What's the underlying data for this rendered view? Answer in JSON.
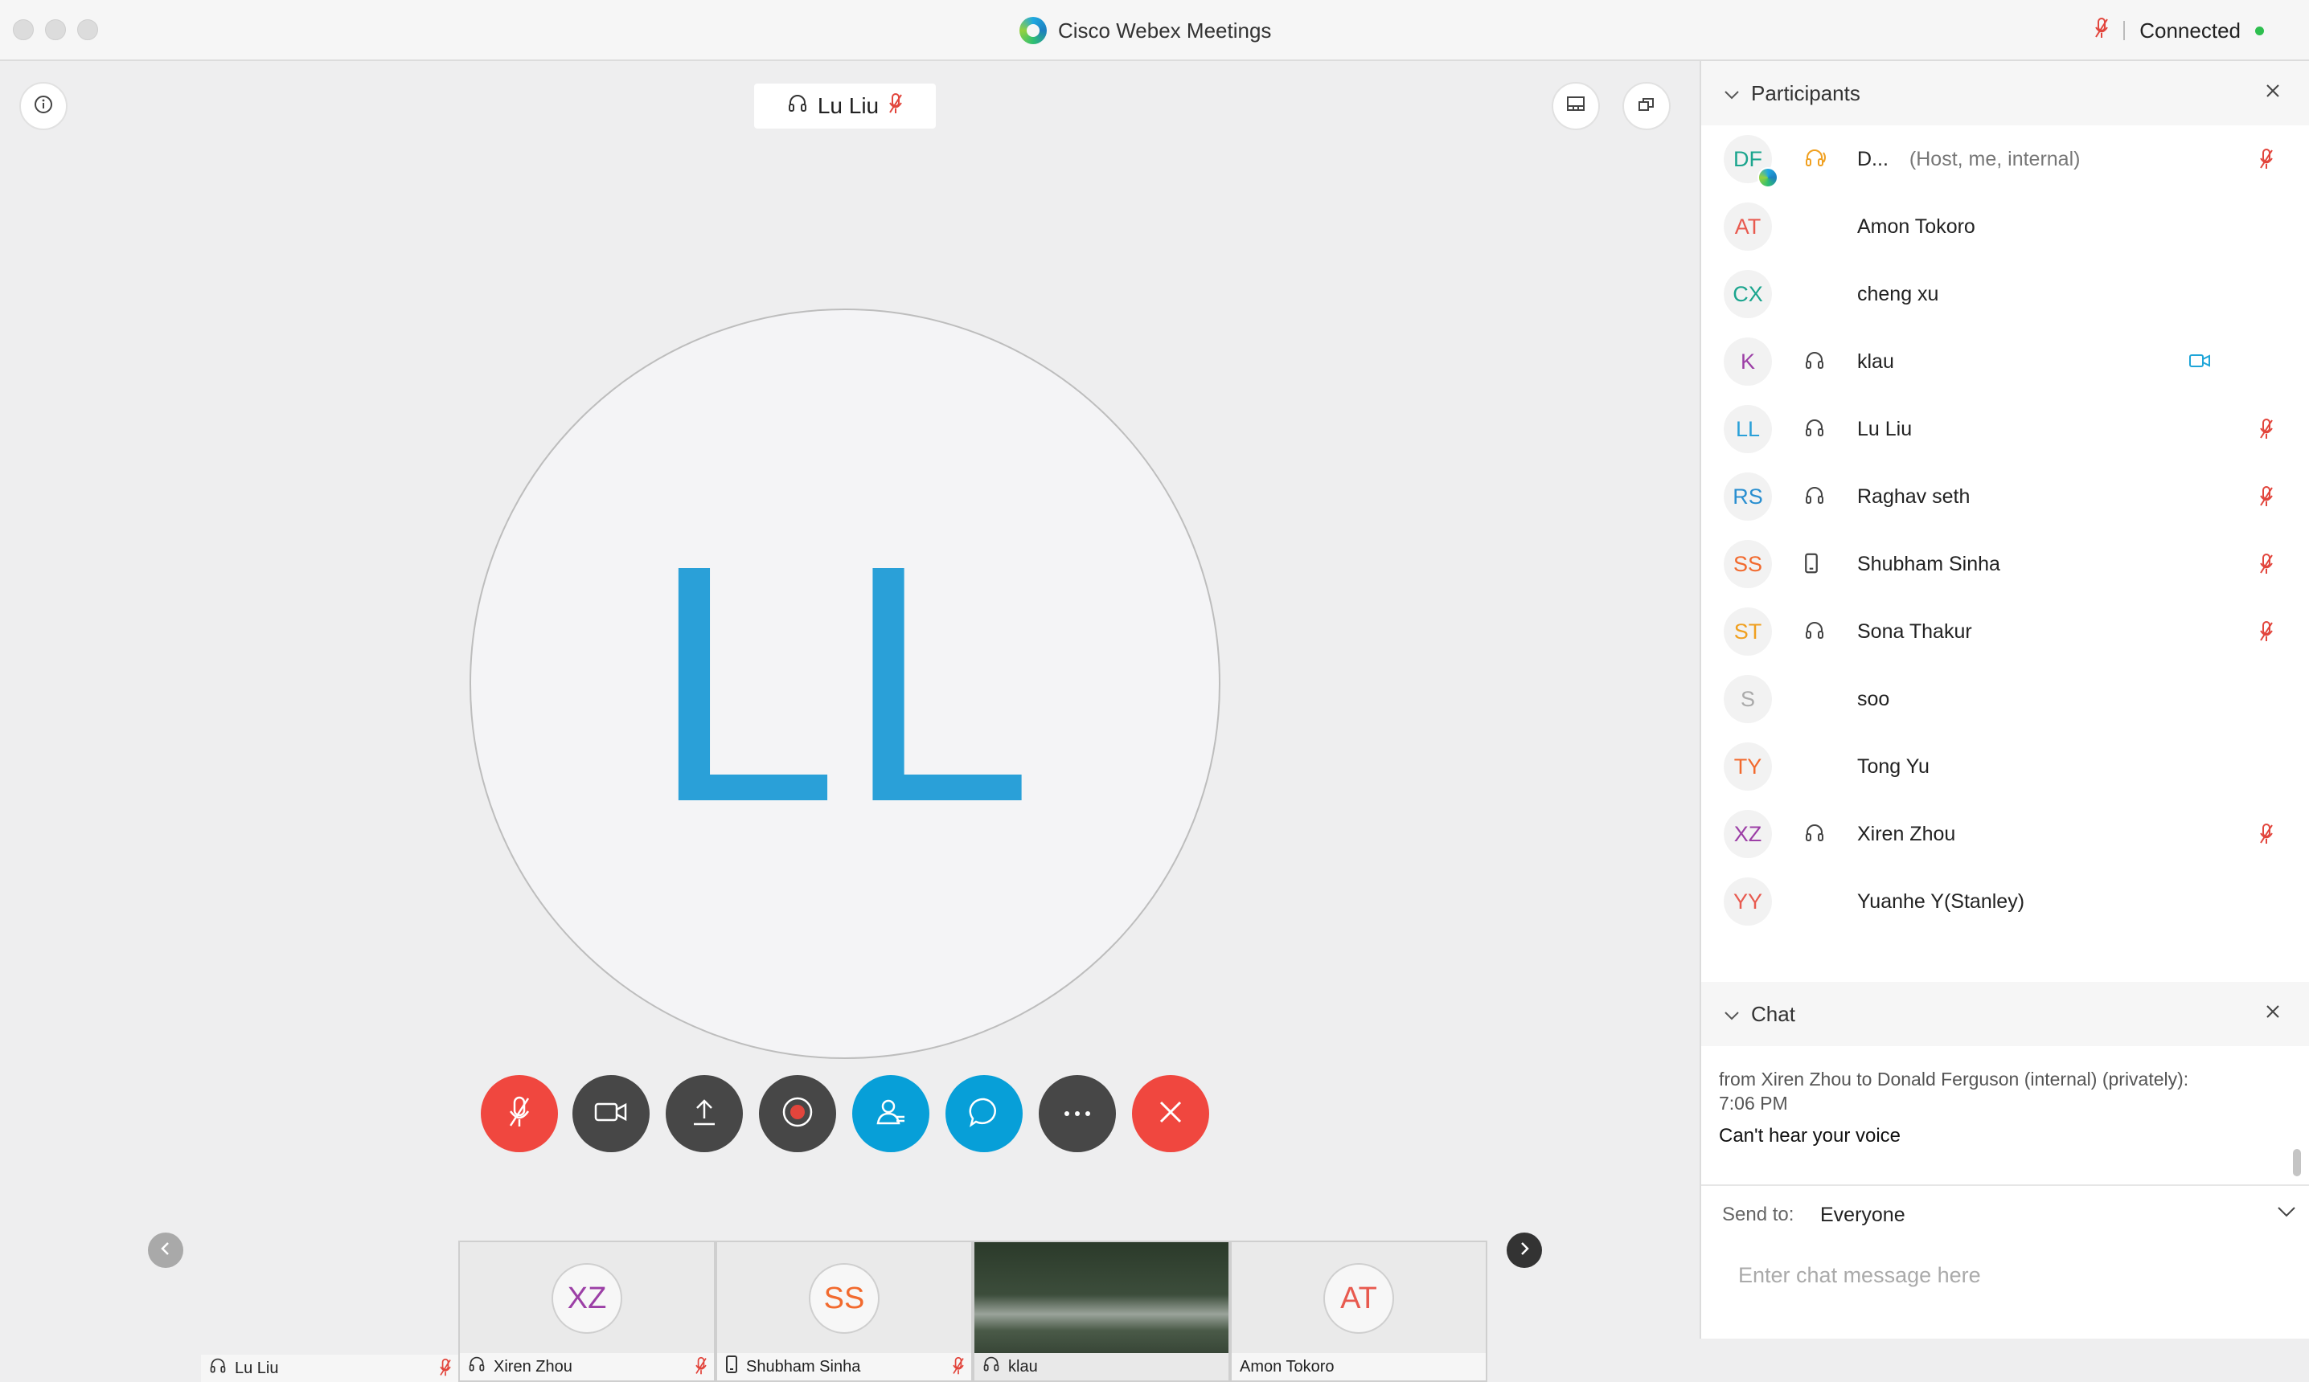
{
  "window": {
    "title": "Cisco Webex Meetings",
    "connection_status": "Connected"
  },
  "stage": {
    "active_speaker": "Lu Liu",
    "active_speaker_initials": "LL",
    "avatar_color": "#2aa0d8"
  },
  "controls": [
    {
      "name": "mute-button",
      "icon": "mic-muted-icon",
      "color": "#f0473f"
    },
    {
      "name": "video-button",
      "icon": "video-camera-icon",
      "color": "#474747"
    },
    {
      "name": "share-button",
      "icon": "share-upload-icon",
      "color": "#474747"
    },
    {
      "name": "record-button",
      "icon": "record-icon",
      "color": "#474747"
    },
    {
      "name": "participants-button",
      "icon": "participants-icon",
      "color": "#079fd8"
    },
    {
      "name": "chat-button",
      "icon": "chat-bubble-icon",
      "color": "#079fd8"
    },
    {
      "name": "more-button",
      "icon": "more-options-icon",
      "color": "#474747"
    },
    {
      "name": "leave-button",
      "icon": "close-x-icon",
      "color": "#f0473f"
    }
  ],
  "thumbnails": [
    {
      "name": "Lu Liu",
      "initials": "",
      "audio": "headset-icon",
      "muted": true
    },
    {
      "name": "Xiren Zhou",
      "initials": "XZ",
      "initials_color": "#9c3fa6",
      "audio": "headset-icon",
      "muted": true
    },
    {
      "name": "Shubham Sinha",
      "initials": "SS",
      "initials_color": "#f26a2e",
      "audio": "phone-icon",
      "muted": true
    },
    {
      "name": "klau",
      "initials": "",
      "audio": "headset-icon",
      "muted": false,
      "video": true
    },
    {
      "name": "Amon Tokoro",
      "initials": "AT",
      "initials_color": "#e85a4f",
      "audio": "",
      "muted": false
    }
  ],
  "participants_panel": {
    "title": "Participants",
    "items": [
      {
        "initials": "DF",
        "initials_color": "#1ba58e",
        "name": "D...",
        "sub": "(Host, me, internal)",
        "audio": "headset-orange-icon",
        "status": "mic-muted-icon"
      },
      {
        "initials": "AT",
        "initials_color": "#e85a4f",
        "name": "Amon Tokoro",
        "sub": "",
        "audio": "",
        "status": ""
      },
      {
        "initials": "CX",
        "initials_color": "#1ba58e",
        "name": "cheng xu",
        "sub": "",
        "audio": "",
        "status": ""
      },
      {
        "initials": "K",
        "initials_color": "#9c3fa6",
        "name": "klau",
        "sub": "",
        "audio": "headset-icon",
        "status": "video-icon"
      },
      {
        "initials": "LL",
        "initials_color": "#2aa0d8",
        "name": "Lu Liu",
        "sub": "",
        "audio": "headset-icon",
        "status": "mic-muted-icon"
      },
      {
        "initials": "RS",
        "initials_color": "#2a8fd0",
        "name": "Raghav seth",
        "sub": "",
        "audio": "headset-icon",
        "status": "mic-muted-icon"
      },
      {
        "initials": "SS",
        "initials_color": "#f26a2e",
        "name": "Shubham Sinha",
        "sub": "",
        "audio": "phone-icon",
        "status": "mic-muted-icon"
      },
      {
        "initials": "ST",
        "initials_color": "#f0a020",
        "name": "Sona Thakur",
        "sub": "",
        "audio": "headset-icon",
        "status": "mic-muted-icon"
      },
      {
        "initials": "S",
        "initials_color": "#aaaaaa",
        "name": "soo",
        "sub": "",
        "audio": "",
        "status": ""
      },
      {
        "initials": "TY",
        "initials_color": "#f26a2e",
        "name": "Tong Yu",
        "sub": "",
        "audio": "",
        "status": ""
      },
      {
        "initials": "XZ",
        "initials_color": "#9c3fa6",
        "name": "Xiren Zhou",
        "sub": "",
        "audio": "headset-icon",
        "status": "mic-muted-icon"
      },
      {
        "initials": "YY",
        "initials_color": "#e85a4f",
        "name": "Yuanhe Y(Stanley)",
        "sub": "",
        "audio": "",
        "status": ""
      }
    ]
  },
  "chat_panel": {
    "title": "Chat",
    "from_line": "from Xiren Zhou to Donald Ferguson (internal) (privately):",
    "time": "7:06  PM",
    "message": "Can't hear your voice",
    "send_to_label": "Send to:",
    "send_to_value": "Everyone",
    "input_placeholder": "Enter chat message here"
  }
}
